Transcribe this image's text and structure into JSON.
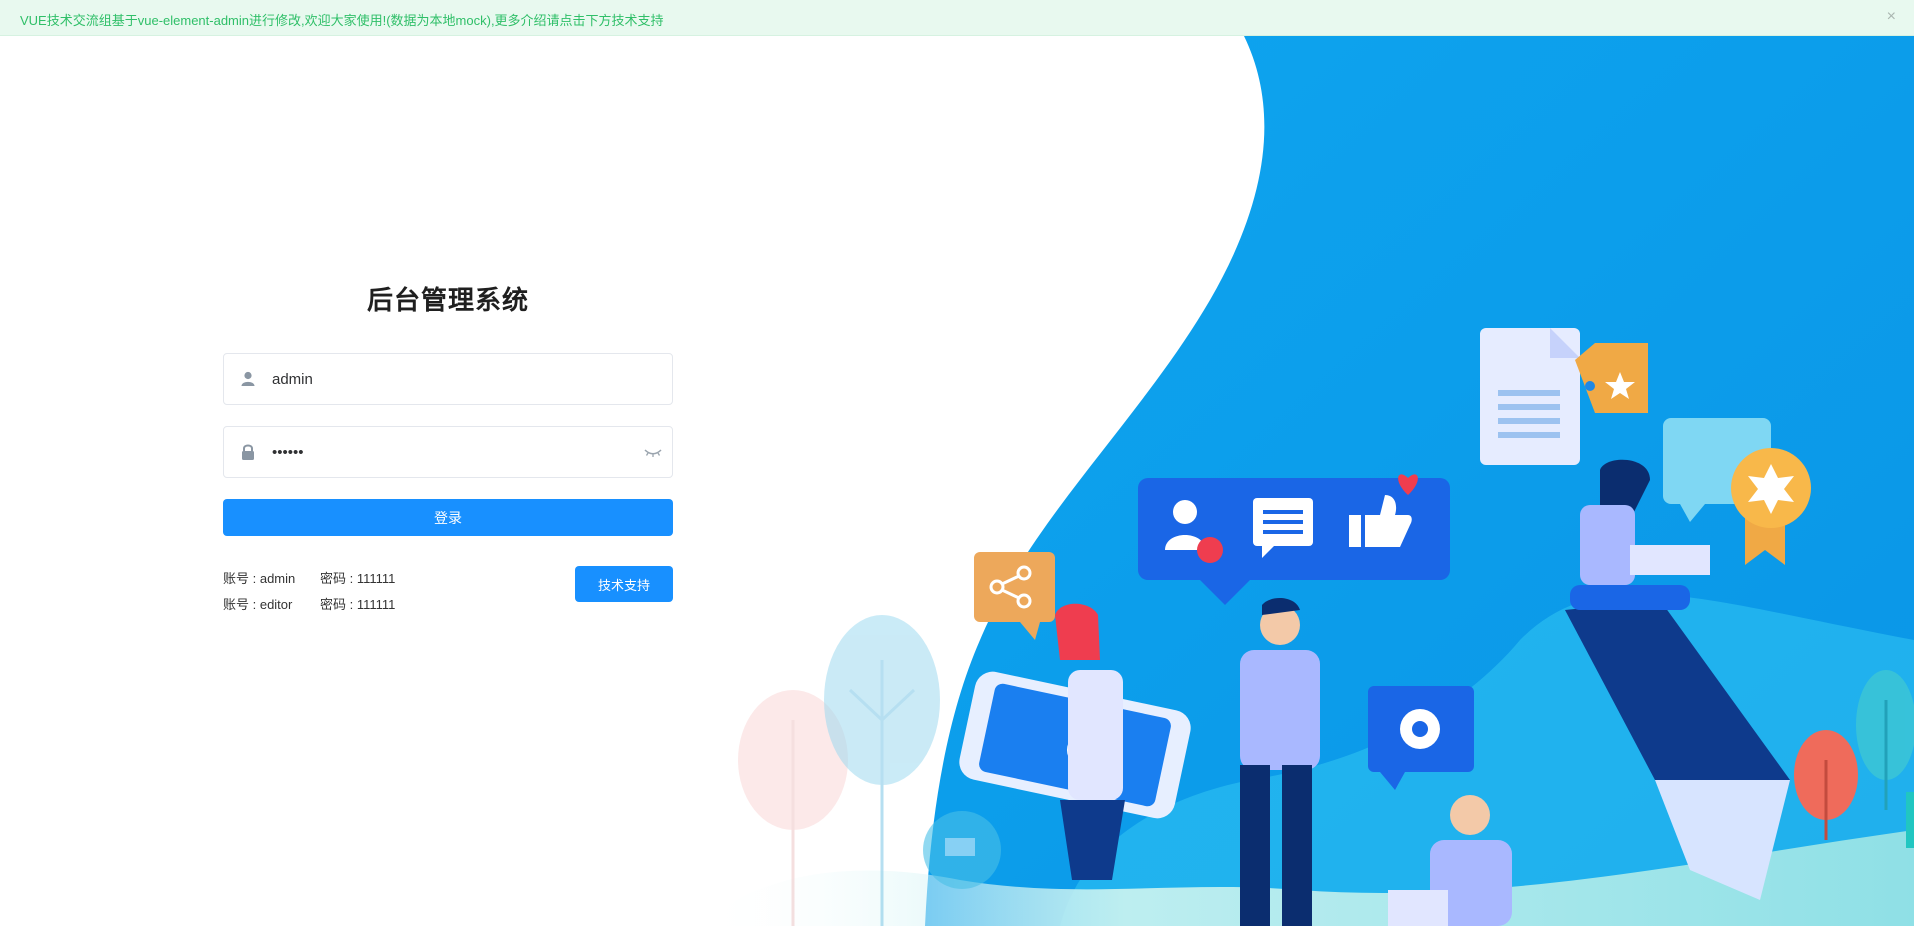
{
  "notice": {
    "text": "VUE技术交流组基于vue-element-admin进行修改,欢迎大家使用!(数据为本地mock),更多介绍请点击下方技术支持",
    "close_symbol": "×"
  },
  "login": {
    "title": "后台管理系统",
    "username_value": "admin",
    "password_value": "111111",
    "submit_label": "登录",
    "user_icon": "user-icon",
    "lock_icon": "lock-icon",
    "toggle_icon": "eye-closed-icon"
  },
  "accounts": [
    {
      "user": "账号 : admin",
      "password": "密码 : 111111"
    },
    {
      "user": "账号 : editor",
      "password": "密码 : 111111"
    }
  ],
  "support_label": "技术支持",
  "colors": {
    "primary": "#1890ff",
    "notice_bg": "#e8f9ef",
    "notice_text": "#2fbf68",
    "illustration_blue": "#0aa2ec"
  }
}
